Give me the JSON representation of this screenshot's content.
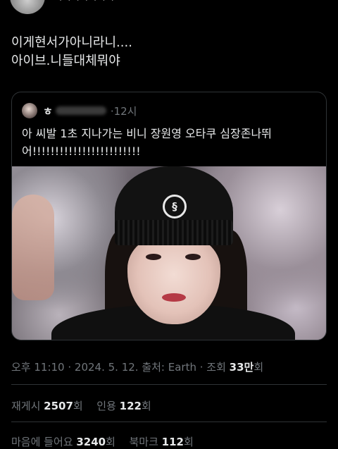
{
  "author": {
    "name_partial": "· · ·  · · · ·"
  },
  "tweet": {
    "text": "이게현서가아니라니....\n아이브.니들대체뭐야"
  },
  "quote": {
    "name": "ㅎ",
    "time": "·12시",
    "text": "아 씨발 1초 지나가는 비니 장원영 오타쿠 심장존나뛰어!!!!!!!!!!!!!!!!!!!!!!!!"
  },
  "meta": {
    "time_date": "오후 11:10 · 2024. 5. 12. 출처: Earth · 조회 ",
    "views_num": "33만",
    "views_unit": "회"
  },
  "stats": {
    "reposts_label": "재게시 ",
    "reposts": "2507",
    "reposts_unit": "회",
    "quotes_label": "인용 ",
    "quotes": "122",
    "quotes_unit": "회",
    "likes_label": "마음에 들어요 ",
    "likes": "3240",
    "likes_unit": "회",
    "bookmarks_label": "북마크 ",
    "bookmarks": "112",
    "bookmarks_unit": "회"
  },
  "colors": {
    "background": "#000000",
    "text": "#e7e9ea",
    "muted": "#71767b",
    "border": "#2f3336"
  }
}
